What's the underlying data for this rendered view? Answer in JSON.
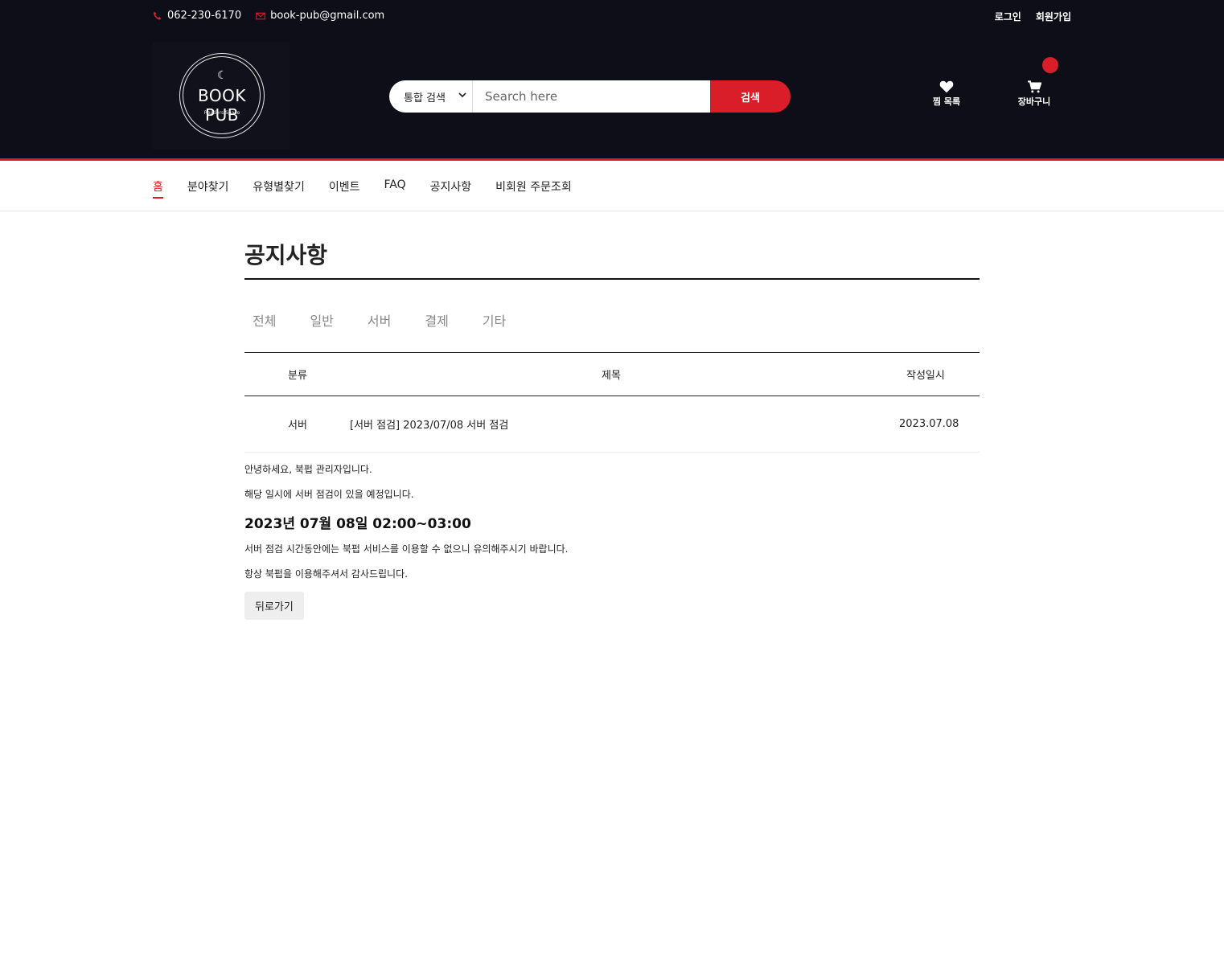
{
  "topbar": {
    "phone": "062-230-6170",
    "email": "book-pub@gmail.com",
    "login": "로그인",
    "signup": "회원가입"
  },
  "header": {
    "logo_brand": "BOOK PUB",
    "logo_tagline": "Readers Space",
    "search_select": "통합 검색",
    "search_placeholder": "Search here",
    "search_button": "검색",
    "wishlist_label": "찜 목록",
    "cart_label": "장바구니"
  },
  "nav": {
    "items": [
      "홈",
      "분야찾기",
      "유형별찾기",
      "이벤트",
      "FAQ",
      "공지사항",
      "비회원 주문조회"
    ]
  },
  "page": {
    "title": "공지사항",
    "categories": [
      "전체",
      "일반",
      "서버",
      "결제",
      "기타"
    ]
  },
  "table": {
    "headers": {
      "category": "분류",
      "title": "제목",
      "date": "작성일시"
    },
    "row": {
      "category": "서버",
      "title": "[서버 점검] 2023/07/08 서버 점검",
      "date": "2023.07.08"
    }
  },
  "notice_body": {
    "line1": "안녕하세요, 북펍 관리자입니다.",
    "line2": "해당 일시에 서버 점검이 있을 예정입니다.",
    "heading": "2023년 07월 08일 02:00~03:00",
    "line3": "서버 점검 시간동안에는 북펍 서비스를 이용할 수 없으니 유의해주시기 바랍니다.",
    "line4": "항상 북펍을 이용해주셔서 감사드립니다."
  },
  "back_button": "뒤로가기",
  "colors": {
    "accent": "#d91e2a",
    "header_bg": "#0d0e17"
  }
}
